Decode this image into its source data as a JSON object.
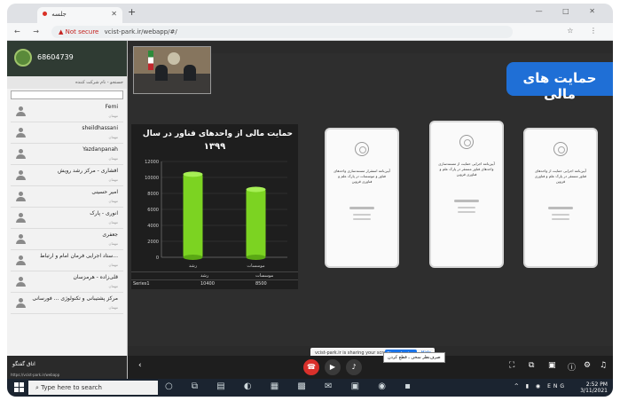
{
  "browser": {
    "tab_title": "جلسه",
    "new_tab": "+",
    "window_controls": "— □ ✕",
    "nav": "← → C",
    "security_label": "▲ Not secure",
    "url": "vcist-park.ir/webapp/#/",
    "addr_icons": "☆ ⋮"
  },
  "sidebar": {
    "room_id": "68604739",
    "search_label": "جستجو - نام شرکت کننده",
    "users": [
      {
        "name": "Femi",
        "role": "مهمان"
      },
      {
        "name": "sheildhassani",
        "role": "مهمان"
      },
      {
        "name": "Yazdanpanah",
        "role": "مهمان"
      },
      {
        "name": "افشاری - مرکز رشد رویش",
        "role": "مهمان"
      },
      {
        "name": "امیر حسینی",
        "role": "مهمان"
      },
      {
        "name": "انوری - پارک",
        "role": "مهمان"
      },
      {
        "name": "جعفری",
        "role": "مهمان"
      },
      {
        "name": "ستاد اجرایی فرمان امام و ارتباط...",
        "role": "مهمان"
      },
      {
        "name": "قلی‌زاده - هرمزسان",
        "role": "مهمان"
      },
      {
        "name": "مرکز پشتیبانی و تکنولوژی ... فورسانی",
        "role": "مهمان"
      }
    ],
    "footer_label": "اتاق گفتگو",
    "footer_url": "https://vcist-park.ir/webapp"
  },
  "slide": {
    "title": "حمایت های مالی",
    "documents": [
      {
        "heading": "آیین‌نامه اجرایی حمایت از واحدهای فناور مستقر در پارک علم و فناوری قزوین"
      },
      {
        "heading": "آیین‌نامه اجرایی حمایت از مستندسازی واحدهای فناور مستقر در پارک علم و فناوری قزوین"
      },
      {
        "heading": "آیین‌نامه استقرار مستندسازی واحدهای فناور و موسسات در پارک علم و فناوری قزوین"
      }
    ]
  },
  "chart_data": {
    "type": "bar",
    "title": "حمایت مالی از واحدهای فناور در سال",
    "subtitle": "۱۳۹۹",
    "categories": [
      "رشد",
      "موسسات"
    ],
    "series": [
      {
        "name": "Series1",
        "values": [
          10400,
          8500
        ]
      }
    ],
    "ylim": [
      0,
      12000
    ],
    "yticks": [
      0,
      2000,
      4000,
      6000,
      8000,
      10000,
      12000
    ],
    "table": {
      "headers": [
        "",
        "رشد",
        "موسسات"
      ],
      "row_label": "Series1",
      "values": [
        "10400",
        "8500"
      ]
    },
    "bar_color": "#7cd322"
  },
  "share": {
    "message": "vcist-park.ir is sharing your screen.",
    "stop_label": "Stop sharing",
    "hide_label": "Hide"
  },
  "controls": {
    "tooltip": "صرف‌نظر سخن ـ قطع کردن",
    "hangup_icon": "phone-hangup-icon",
    "video_icon": "camera-off-icon",
    "mic_icon": "mic-off-icon"
  },
  "taskbar": {
    "search_placeholder": "Type here to search",
    "tray_icons": "^ ▮ ◉ ENG",
    "time": "2:52 PM",
    "date": "3/11/2021"
  }
}
